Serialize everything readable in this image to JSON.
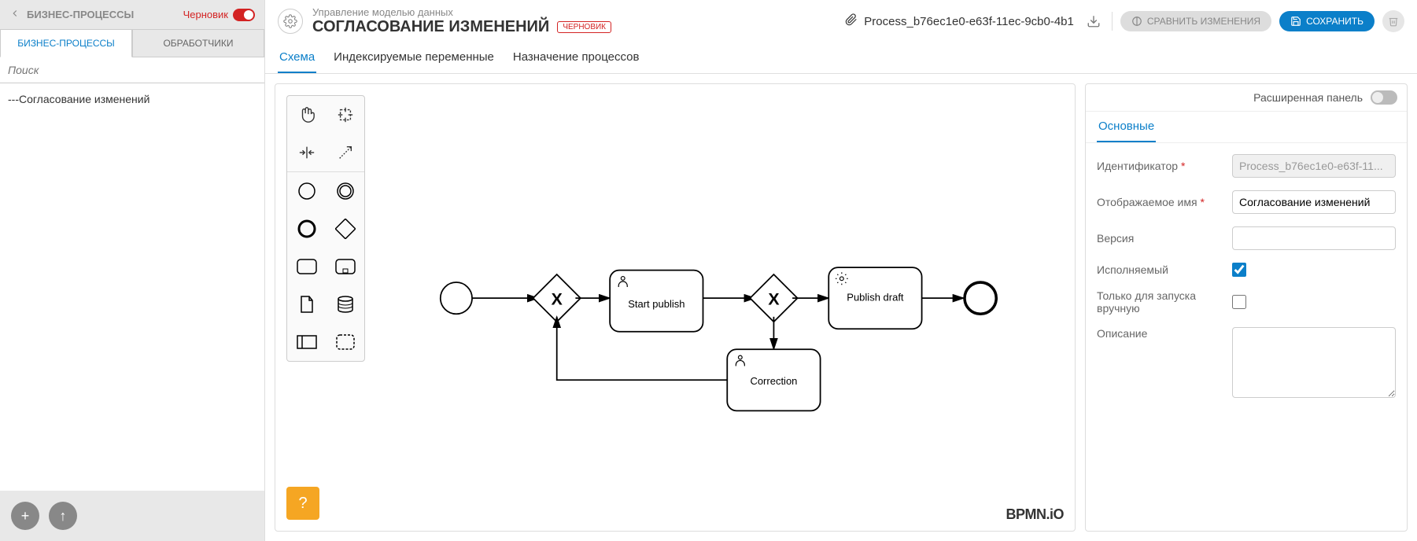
{
  "sidebar": {
    "title": "БИЗНЕС-ПРОЦЕССЫ",
    "draft_label": "Черновик",
    "tabs": [
      "БИЗНЕС-ПРОЦЕССЫ",
      "ОБРАБОТЧИКИ"
    ],
    "search_placeholder": "Поиск",
    "tree_item": "---Согласование изменений"
  },
  "header": {
    "breadcrumb": "Управление моделью данных",
    "title": "СОГЛАСОВАНИЕ ИЗМЕНЕНИЙ",
    "badge": "ЧЕРНОВИК",
    "process_id": "Process_b76ec1e0-e63f-11ec-9cb0-4b1",
    "compare_btn": "СРАВНИТЬ ИЗМЕНЕНИЯ",
    "save_btn": "СОХРАНИТЬ"
  },
  "main_tabs": [
    "Схема",
    "Индексируемые переменные",
    "Назначение процессов"
  ],
  "diagram": {
    "task1": "Start publish",
    "task2": "Publish draft",
    "task3": "Correction",
    "logo": "BPMN.iO"
  },
  "props": {
    "panel_label": "Расширенная панель",
    "tab": "Основные",
    "fields": {
      "id_label": "Идентификатор",
      "id_value": "Process_b76ec1e0-e63f-11...",
      "name_label": "Отображаемое имя",
      "name_value": "Согласование изменений",
      "version_label": "Версия",
      "version_value": "",
      "exec_label": "Исполняемый",
      "manual_label": "Только для запуска вручную",
      "desc_label": "Описание",
      "desc_value": ""
    }
  }
}
